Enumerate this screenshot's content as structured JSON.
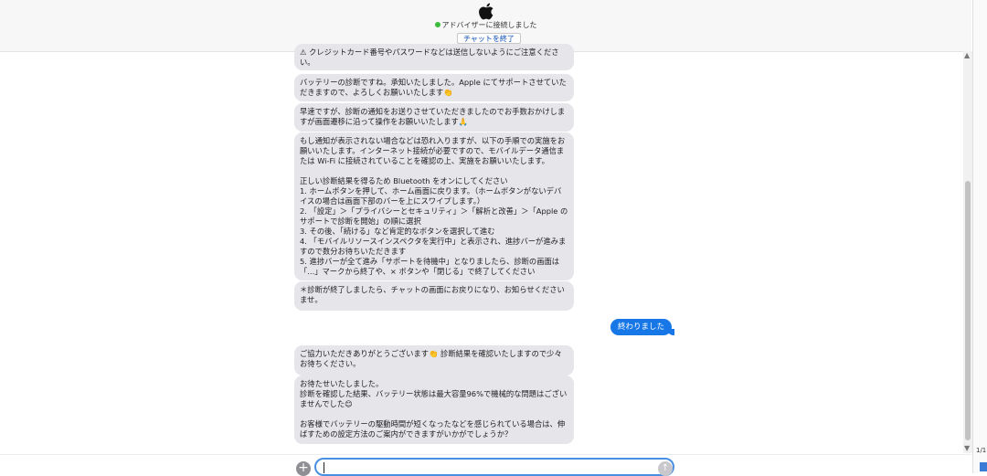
{
  "header": {
    "status_text": "アドバイザーに接続しました",
    "end_chat_label": "チャットを終了",
    "status_color": "#3bbb3b"
  },
  "messages": [
    {
      "text": "⚠ クレジットカード番号やパスワードなどは送信しないようにご注意ください。"
    },
    {
      "text": "バッテリーの診断ですね。承知いたしました。Apple にてサポートさせていただきますので、よろしくお願いいたします👏"
    },
    {
      "text": "早速ですが、診断の通知をお送りさせていただきましたのでお手数おかけしますが画面遷移に沿って操作をお願いいたします🙏"
    },
    {
      "text": "もし通知が表示されない場合などは恐れ入りますが、以下の手順での実施をお願いいたします。インターネット接続が必要ですので、モバイルデータ通信または Wi-Fi に接続されていることを確認の上、実施をお願いいたします。\n\n正しい診断結果を得るため Bluetooth をオンにしてください\n1. ホームボタンを押して、ホーム画面に戻ります。（ホームボタンがないデバイスの場合は画面下部のバーを上にスワイプします。）\n2. 「設定」＞「プライバシーとセキュリティ」＞「解析と改善」＞「Apple のサポートで診断を開始」の順に選択\n3. その後、「続ける」など肯定的なボタンを選択して進む\n4. 「モバイルリソースインスペクタを実行中」と表示され、進捗バーが進みますので数分お待ちいただきます\n5. 進捗バーが全て進み「サポートを待機中」となりましたら、診断の画面は「...」マークから終了や、× ボタンや「閉じる」で終了してください"
    },
    {
      "text": "＊診断が終了しましたら、チャットの画面にお戻りになり、お知らせくださいませ。"
    },
    {
      "text": "ご協力いただきありがとうございます👏 診断結果を確認いたしますので少々お待ちください。"
    },
    {
      "text": "お待たせいたしました。\n診断を確認した結果、バッテリー状態は最大容量96%で機械的な問題はございませんでした😊\n\nお客様でバッテリーの駆動時間が短くなったなどを感じられている場合は、伸ばすための設定方法のご案内ができますがいかがでしょうか？"
    }
  ],
  "user_message": {
    "text": "終わりました"
  },
  "input": {
    "value": "",
    "placeholder": ""
  },
  "icons": {
    "logo": "apple-logo",
    "add": "plus-circle-icon",
    "send": "send-arrow-icon",
    "scroll_up": "triangle-up-icon",
    "scroll_down": "triangle-down-icon"
  },
  "page_indicator": "1/1",
  "colors": {
    "agent_bubble": "#e5e5ea",
    "user_bubble": "#1877e6",
    "input_border": "#4a90e2"
  }
}
